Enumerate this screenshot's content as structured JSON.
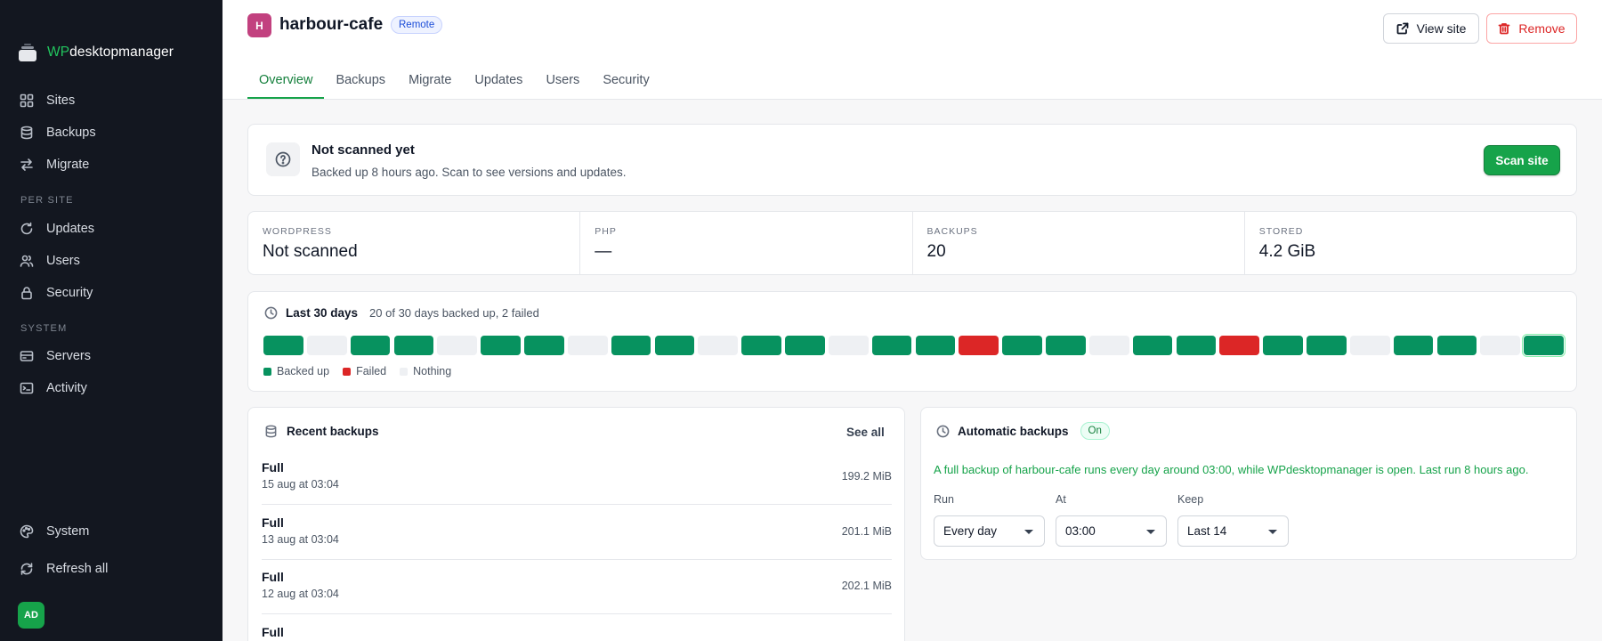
{
  "sidebar": {
    "logo": {
      "prefix": "WP",
      "suffix": "desktopmanager"
    },
    "main_items": [
      {
        "label": "Sites",
        "icon": "grid-icon"
      },
      {
        "label": "Backups",
        "icon": "database-icon"
      },
      {
        "label": "Migrate",
        "icon": "arrows-icon"
      }
    ],
    "per_site_label": "PER SITE",
    "per_site_items": [
      {
        "label": "Updates",
        "icon": "refresh-icon"
      },
      {
        "label": "Users",
        "icon": "users-icon"
      },
      {
        "label": "Security",
        "icon": "lock-icon"
      }
    ],
    "system_label": "SYSTEM",
    "system_items": [
      {
        "label": "Servers",
        "icon": "server-icon"
      },
      {
        "label": "Activity",
        "icon": "terminal-icon"
      }
    ],
    "bottom_items": [
      {
        "label": "System",
        "icon": "palette-icon"
      },
      {
        "label": "Refresh all",
        "icon": "refresh-all-icon"
      }
    ],
    "avatar": "AD"
  },
  "header": {
    "site_initial": "H",
    "site_name": "harbour-cafe",
    "remote_badge": "Remote",
    "view_site": "View site",
    "remove": "Remove",
    "tabs": [
      "Overview",
      "Backups",
      "Migrate",
      "Updates",
      "Users",
      "Security"
    ],
    "active_tab": "Overview"
  },
  "scan": {
    "title": "Not scanned yet",
    "subtitle": "Backed up 8 hours ago. Scan to see versions and updates.",
    "button": "Scan site"
  },
  "stats": [
    {
      "label": "WORDPRESS",
      "value": "Not scanned"
    },
    {
      "label": "PHP",
      "value": "—"
    },
    {
      "label": "BACKUPS",
      "value": "20"
    },
    {
      "label": "STORED",
      "value": "4.2 GiB"
    }
  ],
  "history": {
    "title": "Last 30 days",
    "summary": "20 of 30 days backed up, 2 failed",
    "days": [
      "ok",
      "none",
      "ok",
      "ok",
      "none",
      "ok",
      "ok",
      "none",
      "ok",
      "ok",
      "none",
      "ok",
      "ok",
      "none",
      "ok",
      "ok",
      "failed",
      "ok",
      "ok",
      "none",
      "ok",
      "ok",
      "failed",
      "ok",
      "ok",
      "none",
      "ok",
      "ok",
      "none",
      "ok"
    ],
    "legend": {
      "ok": "Backed up",
      "failed": "Failed",
      "none": "Nothing"
    },
    "colors": {
      "ok": "#07925f",
      "failed": "#dc2626",
      "none": "#eef0f3"
    }
  },
  "recent": {
    "title": "Recent backups",
    "see_all": "See all",
    "rows": [
      {
        "type": "Full",
        "date": "15 aug at 03:04",
        "size": "199.2 MiB"
      },
      {
        "type": "Full",
        "date": "13 aug at 03:04",
        "size": "201.1 MiB"
      },
      {
        "type": "Full",
        "date": "12 aug at 03:04",
        "size": "202.1 MiB"
      },
      {
        "type": "Full",
        "date": "",
        "size": ""
      }
    ]
  },
  "auto": {
    "title": "Automatic backups",
    "status": "On",
    "description": "A full backup of harbour-cafe runs every day around 03:00, while WPdesktopmanager is open. Last run 8 hours ago.",
    "run_label": "Run",
    "run_value": "Every day",
    "at_label": "At",
    "at_value": "03:00",
    "keep_label": "Keep",
    "keep_value": "Last 14"
  }
}
